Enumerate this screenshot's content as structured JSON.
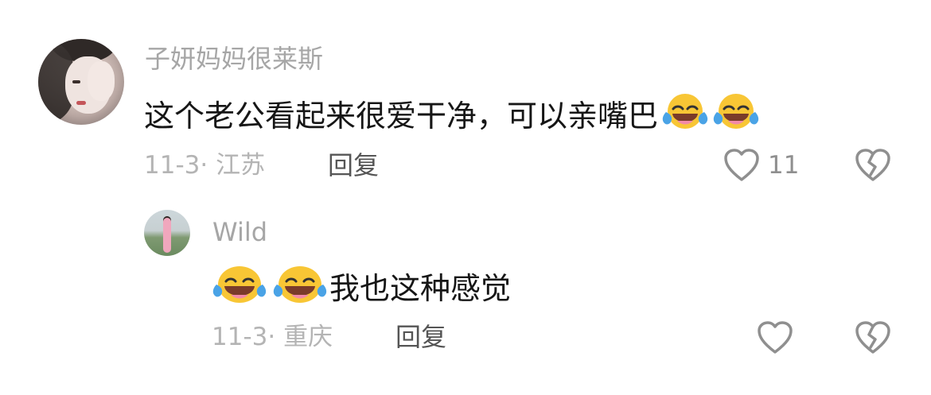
{
  "comments": [
    {
      "username": "子妍妈妈很莱斯",
      "content": "这个老公看起来很爱干净，可以亲嘴巴",
      "emoji_trailing": [
        "laughing-crying-emoji",
        "laughing-crying-emoji"
      ],
      "date_location": "11-3· 江苏",
      "reply_label": "回复",
      "like_count": "11",
      "icons": {
        "like": "heart-outline-icon",
        "dislike": "broken-heart-icon"
      }
    },
    {
      "username": "Wild",
      "emoji_leading": [
        "laughing-crying-emoji",
        "laughing-crying-emoji"
      ],
      "content": "我也这种感觉",
      "date_location": "11-3· 重庆",
      "reply_label": "回复",
      "icons": {
        "like": "heart-outline-icon",
        "dislike": "broken-heart-icon"
      }
    }
  ],
  "colors": {
    "username": "#a6a6a6",
    "content": "#161616",
    "meta": "#b4b4b4",
    "reply": "#555555",
    "icon": "#8f8f8f",
    "emoji_face": "#f8c635",
    "emoji_tear": "#4aa3e6"
  }
}
